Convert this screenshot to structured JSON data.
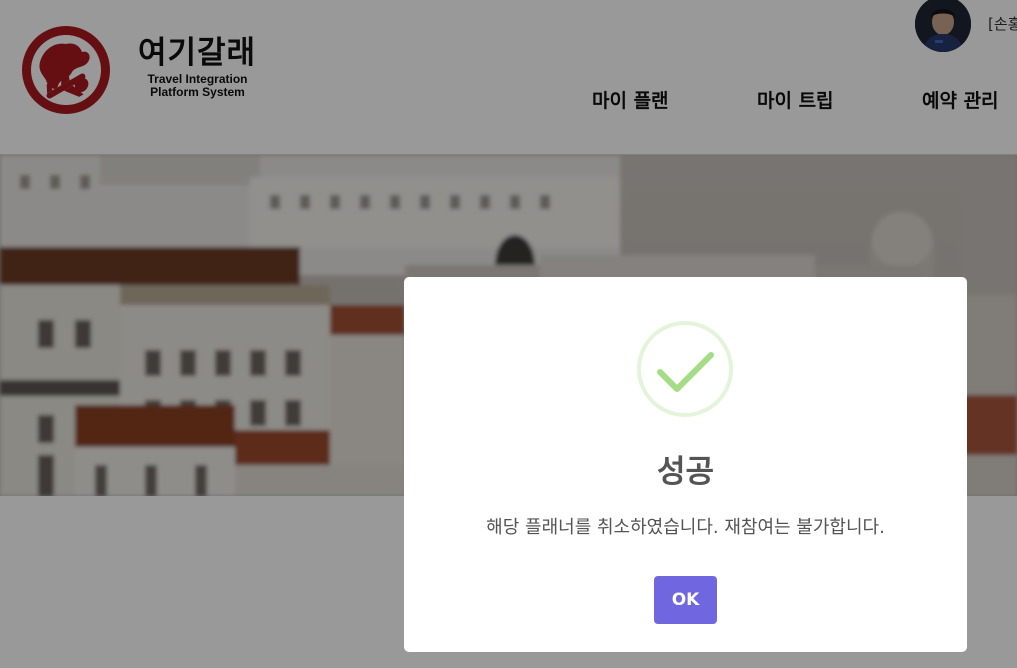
{
  "header": {
    "brand": {
      "name": "여기갈래",
      "subtitle_line1": "Travel Integration",
      "subtitle_line2": "Platform System",
      "logo_icon": "globe-airplane-icon",
      "logo_color": "#a8191f"
    },
    "user": {
      "avatar_icon": "user-avatar",
      "name_partial": "[손홍"
    },
    "nav": {
      "items": [
        {
          "label": "마이 플랜"
        },
        {
          "label": "마이 트립"
        },
        {
          "label": "예약 관리"
        }
      ]
    }
  },
  "hero": {
    "image": "city-rooftops-photo"
  },
  "modal": {
    "icon": "success-check-icon",
    "icon_color": "#a5dc86",
    "title": "성공",
    "message": "해당 플래너를 취소하였습니다. 재참여는 불가합니다.",
    "ok_label": "OK",
    "ok_color": "#7066e0"
  }
}
